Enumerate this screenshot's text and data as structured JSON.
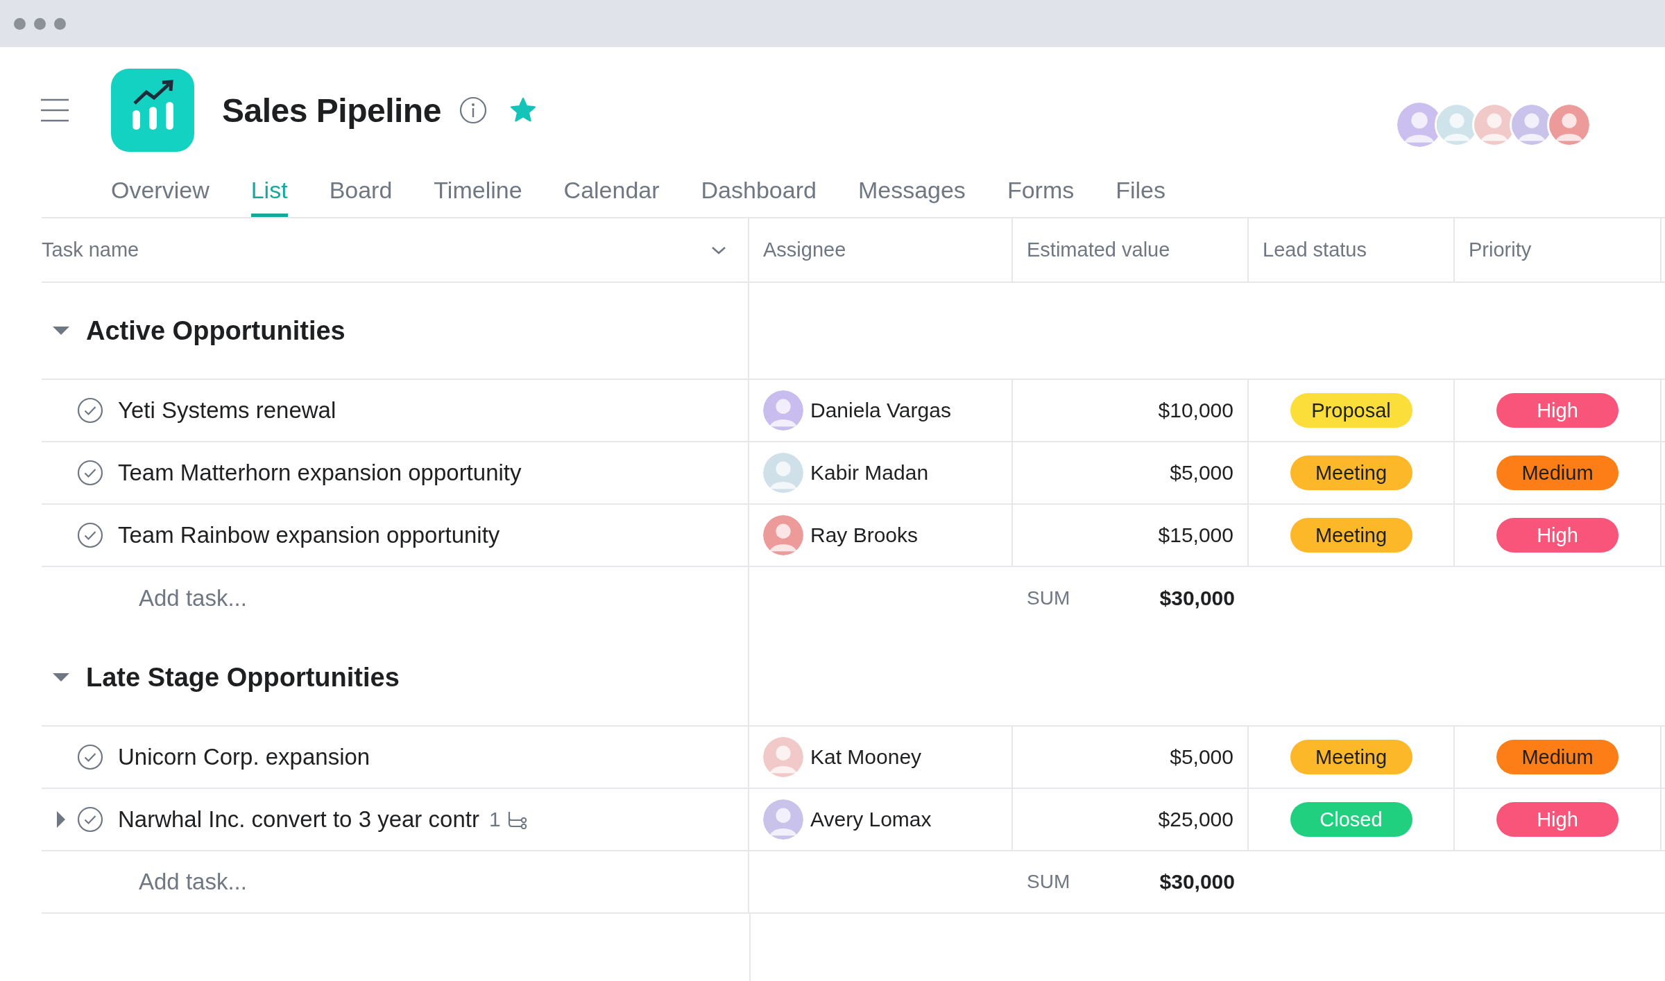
{
  "project": {
    "title": "Sales Pipeline",
    "starred": true
  },
  "members": [
    {
      "color": "#cbbff0"
    },
    {
      "color": "#cfe3ea"
    },
    {
      "color": "#f2c9c9"
    },
    {
      "color": "#c9c3ec"
    },
    {
      "color": "#ec9a9a"
    }
  ],
  "tabs": [
    {
      "label": "Overview",
      "selected": false
    },
    {
      "label": "List",
      "selected": true
    },
    {
      "label": "Board",
      "selected": false
    },
    {
      "label": "Timeline",
      "selected": false
    },
    {
      "label": "Calendar",
      "selected": false
    },
    {
      "label": "Dashboard",
      "selected": false
    },
    {
      "label": "Messages",
      "selected": false
    },
    {
      "label": "Forms",
      "selected": false
    },
    {
      "label": "Files",
      "selected": false
    }
  ],
  "table": {
    "columns": [
      "Task name",
      "Assignee",
      "Estimated value",
      "Lead status",
      "Priority"
    ],
    "sections": [
      {
        "title": "Active Opportunities",
        "expanded": true,
        "add_task": "Add task...",
        "sum_label": "SUM",
        "sum": "$30,000",
        "tasks": [
          {
            "name": "Yeti Systems renewal",
            "completed": false,
            "assignee": {
              "name": "Daniela Vargas",
              "color": "#c9bdf0"
            },
            "value": "$10,000",
            "status": {
              "label": "Proposal",
              "color": "#fcde3a"
            },
            "priority": {
              "label": "High",
              "color": "#f95479"
            }
          },
          {
            "name": "Team Matterhorn expansion opportunity",
            "completed": false,
            "assignee": {
              "name": "Kabir Madan",
              "color": "#cfe0e8"
            },
            "value": "$5,000",
            "status": {
              "label": "Meeting",
              "color": "#fdb82a"
            },
            "priority": {
              "label": "Medium",
              "color": "#fd7e17"
            }
          },
          {
            "name": "Team Rainbow expansion opportunity",
            "completed": false,
            "assignee": {
              "name": "Ray Brooks",
              "color": "#ec9a9a"
            },
            "value": "$15,000",
            "status": {
              "label": "Meeting",
              "color": "#fdb82a"
            },
            "priority": {
              "label": "High",
              "color": "#f95479"
            }
          }
        ]
      },
      {
        "title": "Late Stage Opportunities",
        "expanded": true,
        "add_task": "Add task...",
        "sum_label": "SUM",
        "sum": "$30,000",
        "tasks": [
          {
            "name": "Unicorn Corp. expansion",
            "completed": false,
            "assignee": {
              "name": "Kat Mooney",
              "color": "#f2c9c9"
            },
            "value": "$5,000",
            "status": {
              "label": "Meeting",
              "color": "#fdb82a"
            },
            "priority": {
              "label": "Medium",
              "color": "#fd7e17"
            }
          },
          {
            "name": "Narwhal Inc. convert to 3 year contr",
            "completed": false,
            "expanded": false,
            "subtask_count": "1",
            "assignee": {
              "name": "Avery Lomax",
              "color": "#c9c3ec"
            },
            "value": "$25,000",
            "status": {
              "label": "Closed",
              "color": "#20d07f"
            },
            "priority": {
              "label": "High",
              "color": "#f95479"
            }
          }
        ]
      }
    ]
  }
}
